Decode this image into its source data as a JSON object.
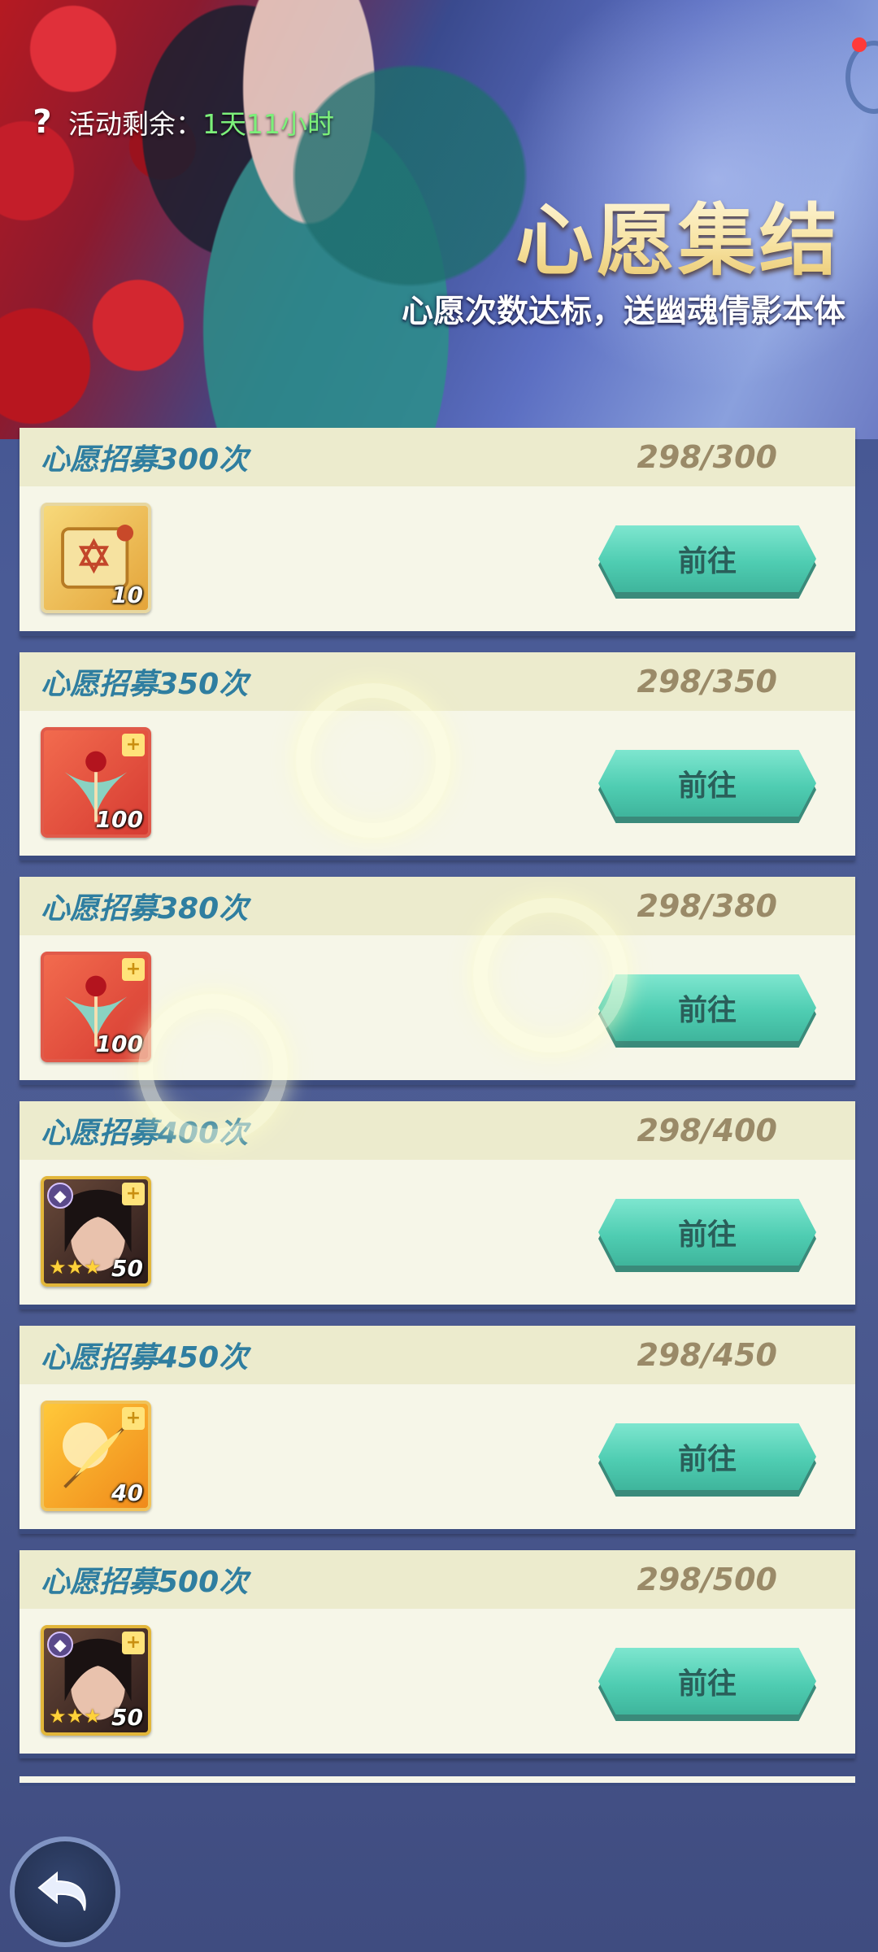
{
  "header": {
    "timer_label": "活动剩余：",
    "timer_value": "1天11小时",
    "title": "心愿集结",
    "subtitle": "心愿次数达标，送幽魂倩影本体"
  },
  "colors": {
    "card_title": "#2f7ea0",
    "progress": "#9a8a68",
    "button": "#4fcdb2",
    "timer_value": "#7cf07a"
  },
  "tasks": [
    {
      "title": "心愿招募300次",
      "progress": "298/300",
      "reward_icon": "scroll-icon",
      "reward_count": "10",
      "button": "前往"
    },
    {
      "title": "心愿招募350次",
      "progress": "298/350",
      "reward_icon": "token-icon",
      "reward_count": "100",
      "button": "前往"
    },
    {
      "title": "心愿招募380次",
      "progress": "298/380",
      "reward_icon": "token-icon",
      "reward_count": "100",
      "button": "前往"
    },
    {
      "title": "心愿招募400次",
      "progress": "298/400",
      "reward_icon": "hero-shard-icon",
      "reward_count": "50",
      "button": "前往"
    },
    {
      "title": "心愿招募450次",
      "progress": "298/450",
      "reward_icon": "feather-icon",
      "reward_count": "40",
      "button": "前往"
    },
    {
      "title": "心愿招募500次",
      "progress": "298/500",
      "reward_icon": "hero-shard-icon",
      "reward_count": "50",
      "button": "前往"
    }
  ]
}
